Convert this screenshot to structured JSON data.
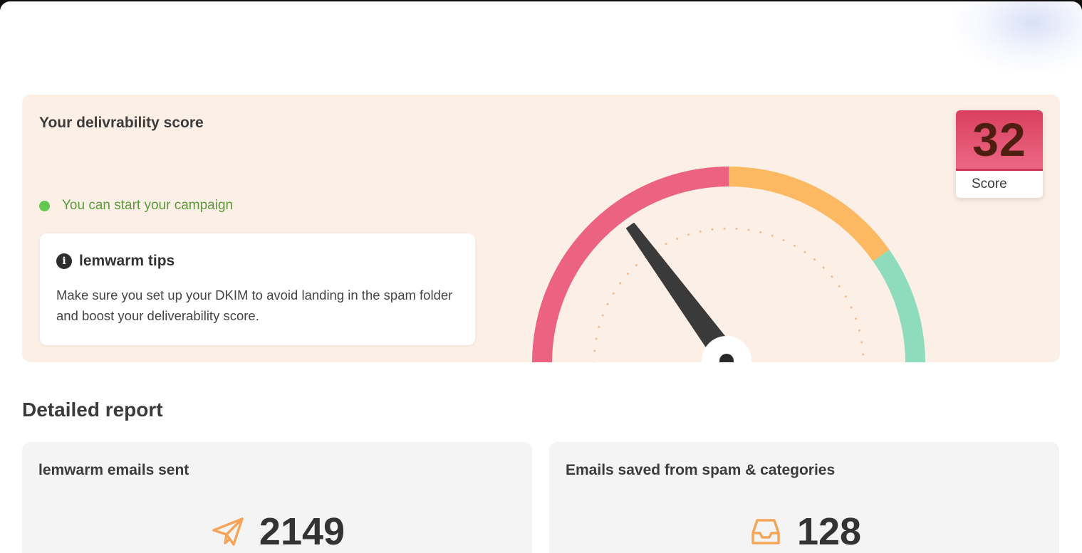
{
  "score_panel": {
    "title": "Your delivrability score",
    "status_text": "You can start your campaign",
    "status_color": "#63c850",
    "tips": {
      "title": "lemwarm tips",
      "body": "Make sure you set up your DKIM to avoid landing in the spam folder and boost your deliverability score."
    },
    "gauge": {
      "segment_colors": [
        "#ec6281",
        "#fdb862",
        "#8fdcbc"
      ],
      "needle_value": 32
    },
    "score": {
      "value": "32",
      "label": "Score"
    }
  },
  "report": {
    "title": "Detailed report",
    "cards": [
      {
        "title": "lemwarm emails sent",
        "value": "2149",
        "icon": "paper-plane-icon",
        "icon_color": "#f5a55a"
      },
      {
        "title": "Emails saved from spam & categories",
        "value": "128",
        "icon": "inbox-tray-icon",
        "icon_color": "#f5a55a"
      }
    ]
  }
}
